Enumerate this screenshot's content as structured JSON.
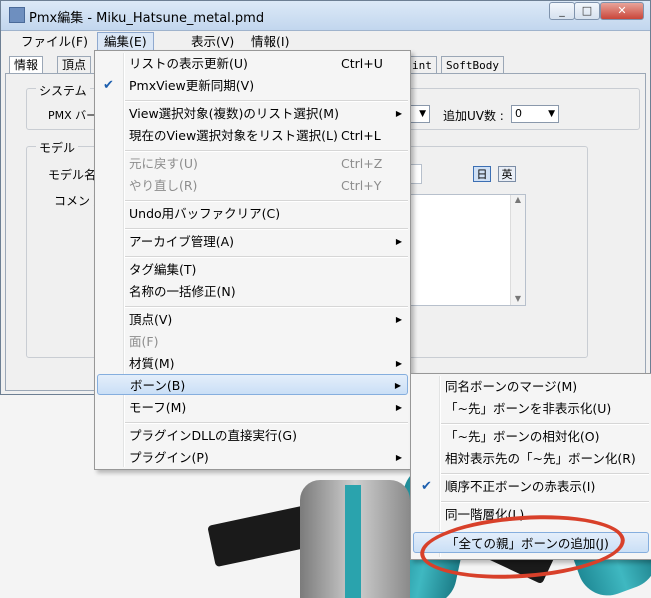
{
  "window": {
    "title": "Pmx編集 - Miku_Hatsune_metal.pmd",
    "minimize_icon": "minimize-icon",
    "maximize_icon": "maximize-icon",
    "close_icon": "close-icon"
  },
  "menubar": [
    {
      "label": "ファイル(F)"
    },
    {
      "label": "編集(E)"
    },
    {
      "label": "表示(V)"
    },
    {
      "label": "情報(I)"
    }
  ],
  "tabs": [
    "情報",
    "頂点",
    "int",
    "SoftBody"
  ],
  "panel": {
    "system_label": "システム",
    "pmx_label": "PMX バー",
    "add_uv_label": "追加UV数 :",
    "add_uv_value": "0",
    "model_label": "モデル",
    "model_name_label": "モデル名",
    "comment_label": "コメント",
    "lang_jp": "日",
    "lang_en": "英"
  },
  "edit_menu": [
    {
      "label": "リストの表示更新(U)",
      "shortcut": "Ctrl+U",
      "checked": false,
      "disabled": false,
      "submenu": false
    },
    {
      "label": "PmxView更新同期(V)",
      "shortcut": "",
      "checked": true,
      "disabled": false,
      "submenu": false
    },
    {
      "label": "View選択対象(複数)のリスト選択(M)",
      "shortcut": "",
      "checked": false,
      "disabled": false,
      "submenu": true
    },
    {
      "label": "現在のView選択対象をリスト選択(L)",
      "shortcut": "Ctrl+L",
      "checked": false,
      "disabled": false,
      "submenu": false
    },
    {
      "label": "元に戻す(U)",
      "shortcut": "Ctrl+Z",
      "checked": false,
      "disabled": true,
      "submenu": false
    },
    {
      "label": "やり直し(R)",
      "shortcut": "Ctrl+Y",
      "checked": false,
      "disabled": true,
      "submenu": false
    },
    {
      "label": "Undo用バッファクリア(C)",
      "shortcut": "",
      "checked": false,
      "disabled": false,
      "submenu": false
    },
    {
      "label": "アーカイブ管理(A)",
      "shortcut": "",
      "checked": false,
      "disabled": false,
      "submenu": true
    },
    {
      "label": "タグ編集(T)",
      "shortcut": "",
      "checked": false,
      "disabled": false,
      "submenu": false
    },
    {
      "label": "名称の一括修正(N)",
      "shortcut": "",
      "checked": false,
      "disabled": false,
      "submenu": false
    },
    {
      "label": "頂点(V)",
      "shortcut": "",
      "checked": false,
      "disabled": false,
      "submenu": true
    },
    {
      "label": "面(F)",
      "shortcut": "",
      "checked": false,
      "disabled": true,
      "submenu": false
    },
    {
      "label": "材質(M)",
      "shortcut": "",
      "checked": false,
      "disabled": false,
      "submenu": true
    },
    {
      "label": "ボーン(B)",
      "shortcut": "",
      "checked": false,
      "disabled": false,
      "submenu": true,
      "highlighted": true
    },
    {
      "label": "モーフ(M)",
      "shortcut": "",
      "checked": false,
      "disabled": false,
      "submenu": true
    },
    {
      "label": "プラグインDLLの直接実行(G)",
      "shortcut": "",
      "checked": false,
      "disabled": false,
      "submenu": false
    },
    {
      "label": "プラグイン(P)",
      "shortcut": "",
      "checked": false,
      "disabled": false,
      "submenu": true
    }
  ],
  "bone_submenu": [
    {
      "label": "同名ボーンのマージ(M)",
      "checked": false
    },
    {
      "label": "「~先」ボーンを非表示化(U)",
      "checked": false
    },
    {
      "label": "「~先」ボーンの相対化(O)",
      "checked": false
    },
    {
      "label": "相対表示先の「~先」ボーン化(R)",
      "checked": false
    },
    {
      "label": "順序不正ボーンの赤表示(I)",
      "checked": true
    },
    {
      "label": "同一階層化(L)",
      "checked": false
    },
    {
      "label": "「全ての親」ボーンの追加(J)",
      "checked": false,
      "highlighted": true
    }
  ],
  "colors": {
    "highlight_border": "#85aede",
    "annotation": "#d8402a",
    "hair": "#3fb8c1"
  }
}
